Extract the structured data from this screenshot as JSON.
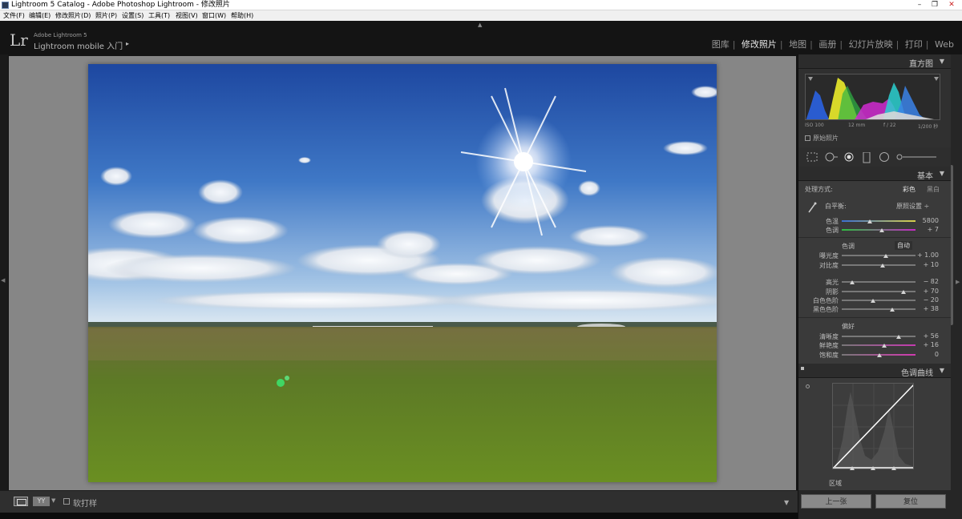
{
  "window": {
    "title": "Lightroom 5 Catalog - Adobe Photoshop Lightroom - 修改照片"
  },
  "menubar": {
    "items": [
      "文件(F)",
      "编辑(E)",
      "修改照片(D)",
      "照片(P)",
      "设置(S)",
      "工具(T)",
      "视图(V)",
      "窗口(W)",
      "帮助(H)"
    ]
  },
  "identity": {
    "logo": "Lr",
    "small_text": "Adobe Lightroom 5",
    "main_text": "Lightroom mobile 入门",
    "arrow": "▸"
  },
  "modules": {
    "items": [
      "图库",
      "修改照片",
      "地图",
      "画册",
      "幻灯片放映",
      "打印",
      "Web"
    ],
    "active": "修改照片"
  },
  "histogram": {
    "header": "直方图",
    "iso": "ISO 100",
    "focal": "12 mm",
    "aperture": "f / 22",
    "shutter": "1/200 秒",
    "original_photo_label": "原始照片"
  },
  "basic": {
    "header": "基本",
    "treatment_label": "处理方式:",
    "treatment_color": "彩色",
    "treatment_bw": "黑白",
    "wb_label": "白平衡:",
    "wb_value": "原照设置 ÷",
    "temp_label": "色温",
    "temp_value": "5800",
    "tint_label": "色调",
    "tint_value": "+ 7",
    "tone_label": "色调",
    "auto_label": "自动",
    "exposure_label": "曝光度",
    "exposure_value": "+ 1.00",
    "contrast_label": "对比度",
    "contrast_value": "+ 10",
    "highlights_label": "高光",
    "highlights_value": "− 82",
    "shadows_label": "阴影",
    "shadows_value": "+ 70",
    "whites_label": "白色色阶",
    "whites_value": "− 20",
    "blacks_label": "黑色色阶",
    "blacks_value": "+ 38",
    "presence_label": "偏好",
    "clarity_label": "清晰度",
    "clarity_value": "+ 56",
    "vibrance_label": "鲜艳度",
    "vibrance_value": "+ 16",
    "saturation_label": "饱和度",
    "saturation_value": "0"
  },
  "tone_curve": {
    "header": "色调曲线",
    "region_label": "区域"
  },
  "toolbar": {
    "view_mode_label": "YY",
    "soft_proof_label": "软打样"
  },
  "nav": {
    "previous_label": "上一张",
    "reset_label": "复位"
  },
  "colors": {
    "panel_bg": "#262626",
    "photo_bg": "#868686",
    "active_module": "#e8e8e8"
  }
}
